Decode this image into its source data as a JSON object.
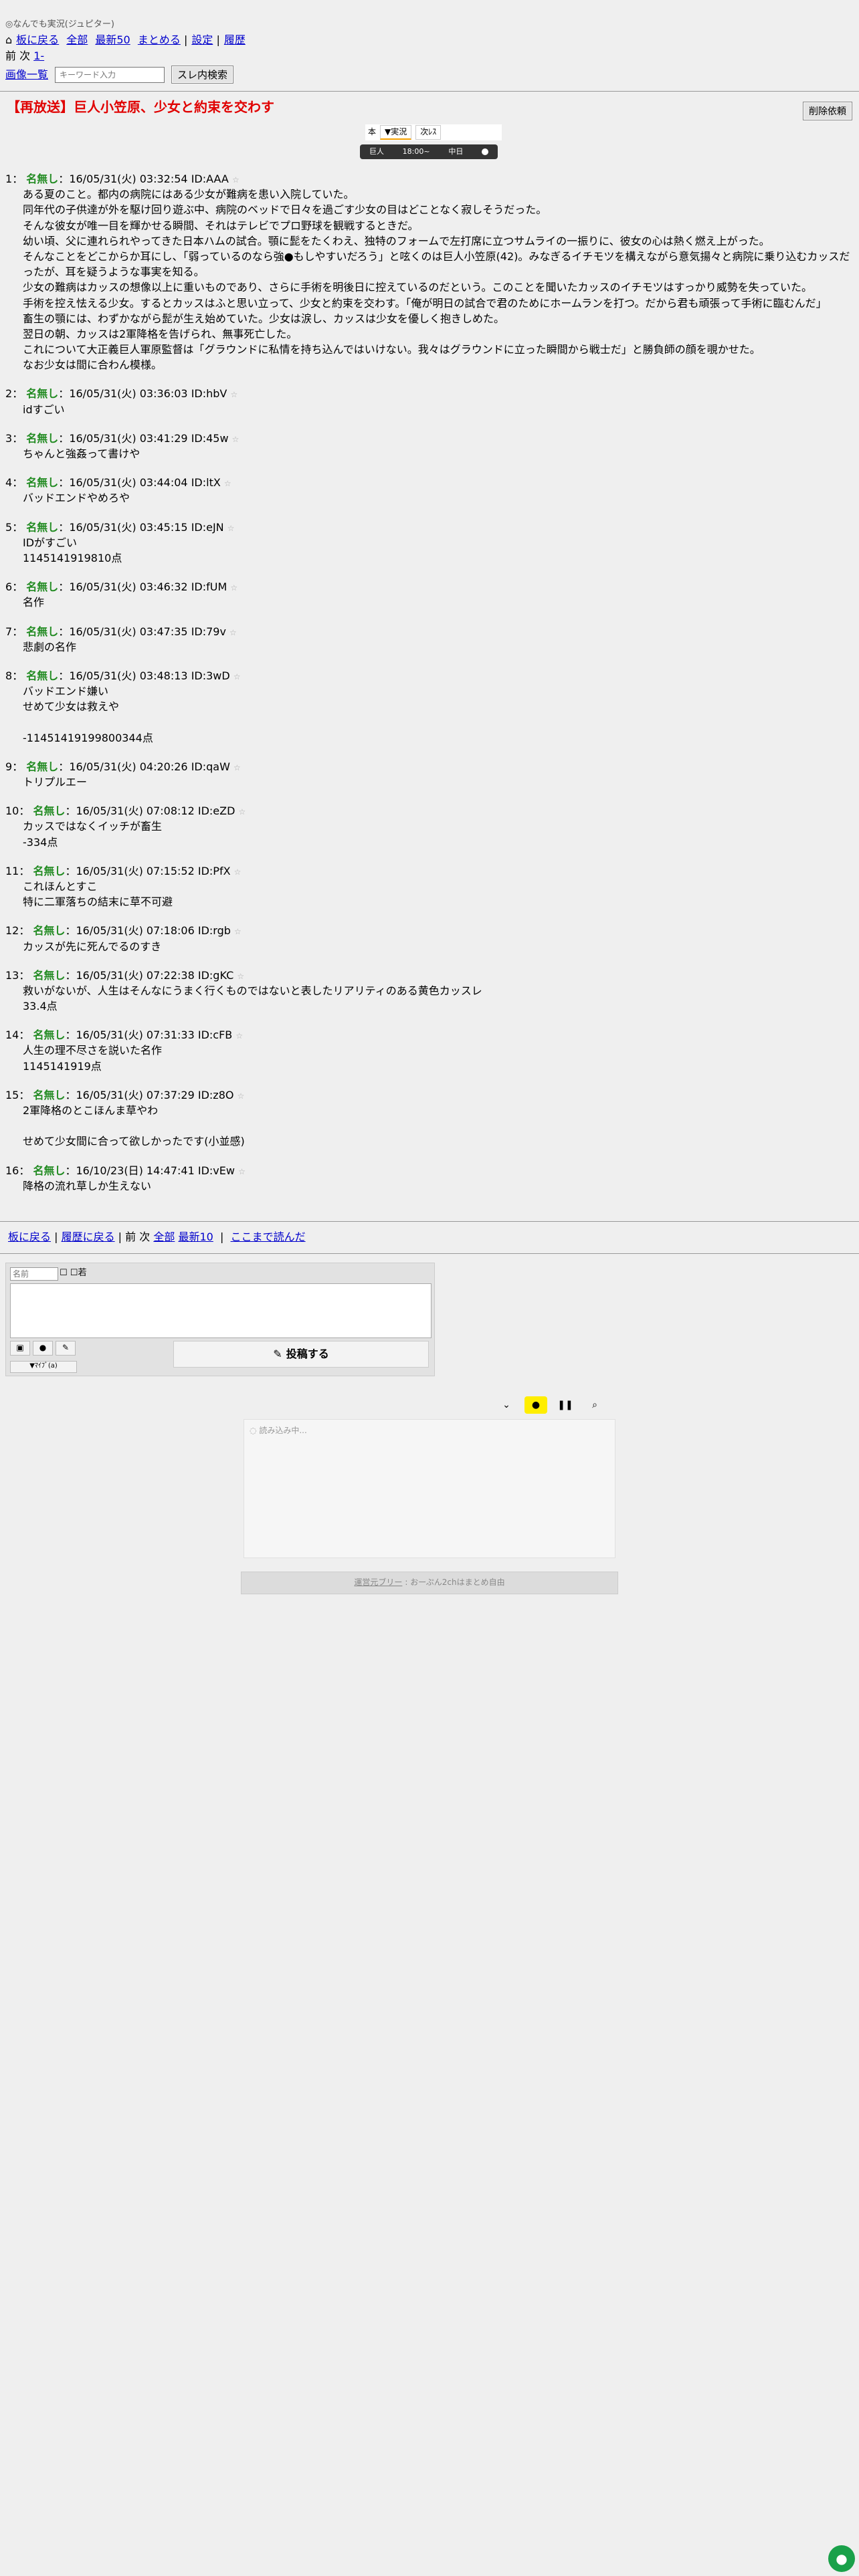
{
  "board_name": "◎なんでも実況(ジュピター)",
  "topnav": {
    "back": "板に戻る",
    "all": "全部",
    "latest50": "最新50",
    "summary": "まとめる",
    "settings": "設定",
    "history": "履歴"
  },
  "pagenav": {
    "prevnext": "前 次",
    "range": "1-"
  },
  "search": {
    "image_list": "画像一覧",
    "placeholder": "キーワード入力",
    "button": "スレ内検索"
  },
  "thread_title": "【再放送】巨人小笠原、少女と約束を交わす",
  "delete_button": "削除依頼",
  "tabs": {
    "checkbox_label": "本",
    "live": "▼実況",
    "next": "次ﾚｽ"
  },
  "live_bar": {
    "team1": "巨人",
    "time": "18:00~",
    "team2": "中日"
  },
  "posts": [
    {
      "num": "1",
      "name": "名無し",
      "meta": "16/05/31(火) 03:32:54 ID:AAA",
      "body": "ある夏のこと。都内の病院にはある少女が難病を患い入院していた。\n同年代の子供達が外を駆け回り遊ぶ中、病院のベッドで日々を過ごす少女の目はどことなく寂しそうだった。\nそんな彼女が唯一目を輝かせる瞬間、それはテレビでプロ野球を観戦するときだ。\n幼い頃、父に連れられやってきた日本ハムの試合。顎に髭をたくわえ、独特のフォームで左打席に立つサムライの一振りに、彼女の心は熱く燃え上がった。\nそんなことをどこからか耳にし、「弱っているのなら強●もしやすいだろう」と呟くのは巨人小笠原(42)。みなぎるイチモツを構えながら意気揚々と病院に乗り込むカッスだったが、耳を疑うような事実を知る。\n少女の難病はカッスの想像以上に重いものであり、さらに手術を明後日に控えているのだという。このことを聞いたカッスのイチモツはすっかり威勢を失っていた。\n手術を控え怯える少女。するとカッスはふと思い立って、少女と約束を交わす。「俺が明日の試合で君のためにホームランを打つ。だから君も頑張って手術に臨むんだ」\n畜生の顎には、わずかながら髭が生え始めていた。少女は涙し、カッスは少女を優しく抱きしめた。\n翌日の朝、カッスは2軍降格を告げられ、無事死亡した。\nこれについて大正義巨人軍原監督は「グラウンドに私情を持ち込んではいけない。我々はグラウンドに立った瞬間から戦士だ」と勝負師の顔を覗かせた。\nなお少女は間に合わん模様。"
    },
    {
      "num": "2",
      "name": "名無し",
      "meta": "16/05/31(火) 03:36:03 ID:hbV",
      "body": "idすごい"
    },
    {
      "num": "3",
      "name": "名無し",
      "meta": "16/05/31(火) 03:41:29 ID:45w",
      "body": "ちゃんと強姦って書けや"
    },
    {
      "num": "4",
      "name": "名無し",
      "meta": "16/05/31(火) 03:44:04 ID:ltX",
      "body": "バッドエンドやめろや"
    },
    {
      "num": "5",
      "name": "名無し",
      "meta": "16/05/31(火) 03:45:15 ID:eJN",
      "body": "IDがすごい\n1145141919810点"
    },
    {
      "num": "6",
      "name": "名無し",
      "meta": "16/05/31(火) 03:46:32 ID:fUM",
      "body": "名作"
    },
    {
      "num": "7",
      "name": "名無し",
      "meta": "16/05/31(火) 03:47:35 ID:79v",
      "body": "悲劇の名作"
    },
    {
      "num": "8",
      "name": "名無し",
      "meta": "16/05/31(火) 03:48:13 ID:3wD",
      "body": "バッドエンド嫌い\nせめて少女は救えや\n\n-114514191998003​44点"
    },
    {
      "num": "9",
      "name": "名無し",
      "meta": "16/05/31(火) 04:20:26 ID:qaW",
      "body": "トリプルエー"
    },
    {
      "num": "10",
      "name": "名無し",
      "meta": "16/05/31(火) 07:08:12 ID:eZD",
      "body": "カッスではなくイッチが畜生\n-334点"
    },
    {
      "num": "11",
      "name": "名無し",
      "meta": "16/05/31(火) 07:15:52 ID:PfX",
      "body": "これほんとすこ\n特に二軍落ちの結末に草不可避"
    },
    {
      "num": "12",
      "name": "名無し",
      "meta": "16/05/31(火) 07:18:06 ID:rgb",
      "body": "カッスが先に死んでるのすき"
    },
    {
      "num": "13",
      "name": "名無し",
      "meta": "16/05/31(火) 07:22:38 ID:gKC",
      "body": "救いがないが、人生はそんなにうまく行くものではないと表したリアリティのある黄色カッスレ\n33.4点"
    },
    {
      "num": "14",
      "name": "名無し",
      "meta": "16/05/31(火) 07:31:33 ID:cFB",
      "body": "人生の理不尽さを説いた名作\n1145141919点"
    },
    {
      "num": "15",
      "name": "名無し",
      "meta": "16/05/31(火) 07:37:29 ID:z8O",
      "body": "2軍降格のとこほんま草やわ\n\nせめて少女間に合って欲しかったです(小並感)"
    },
    {
      "num": "16",
      "name": "名無し",
      "meta": "16/10/23(日) 14:47:41 ID:vEw",
      "body": "降格の流れ草しか生えない"
    }
  ],
  "bottomnav": {
    "back": "板に戻る",
    "history_back": "履歴に戻る",
    "prevnext": "前 次",
    "all": "全部",
    "latest10": "最新10",
    "readto": "ここまで読んだ"
  },
  "form": {
    "name_placeholder": "名前",
    "sage": "☐ ☐若",
    "submit": "投稿する",
    "small": "▼ﾏｲﾌﾞ(a)"
  },
  "chat": {
    "loading": "読み込み中..."
  },
  "footer": {
    "link": "運営元ブリー",
    "text": ": おーぷん2chはまとめ自由"
  },
  "colors": {
    "title": "#e00000",
    "name": "#228b22",
    "link": "#0000cc",
    "chat_bubble": "#1aa14a"
  }
}
